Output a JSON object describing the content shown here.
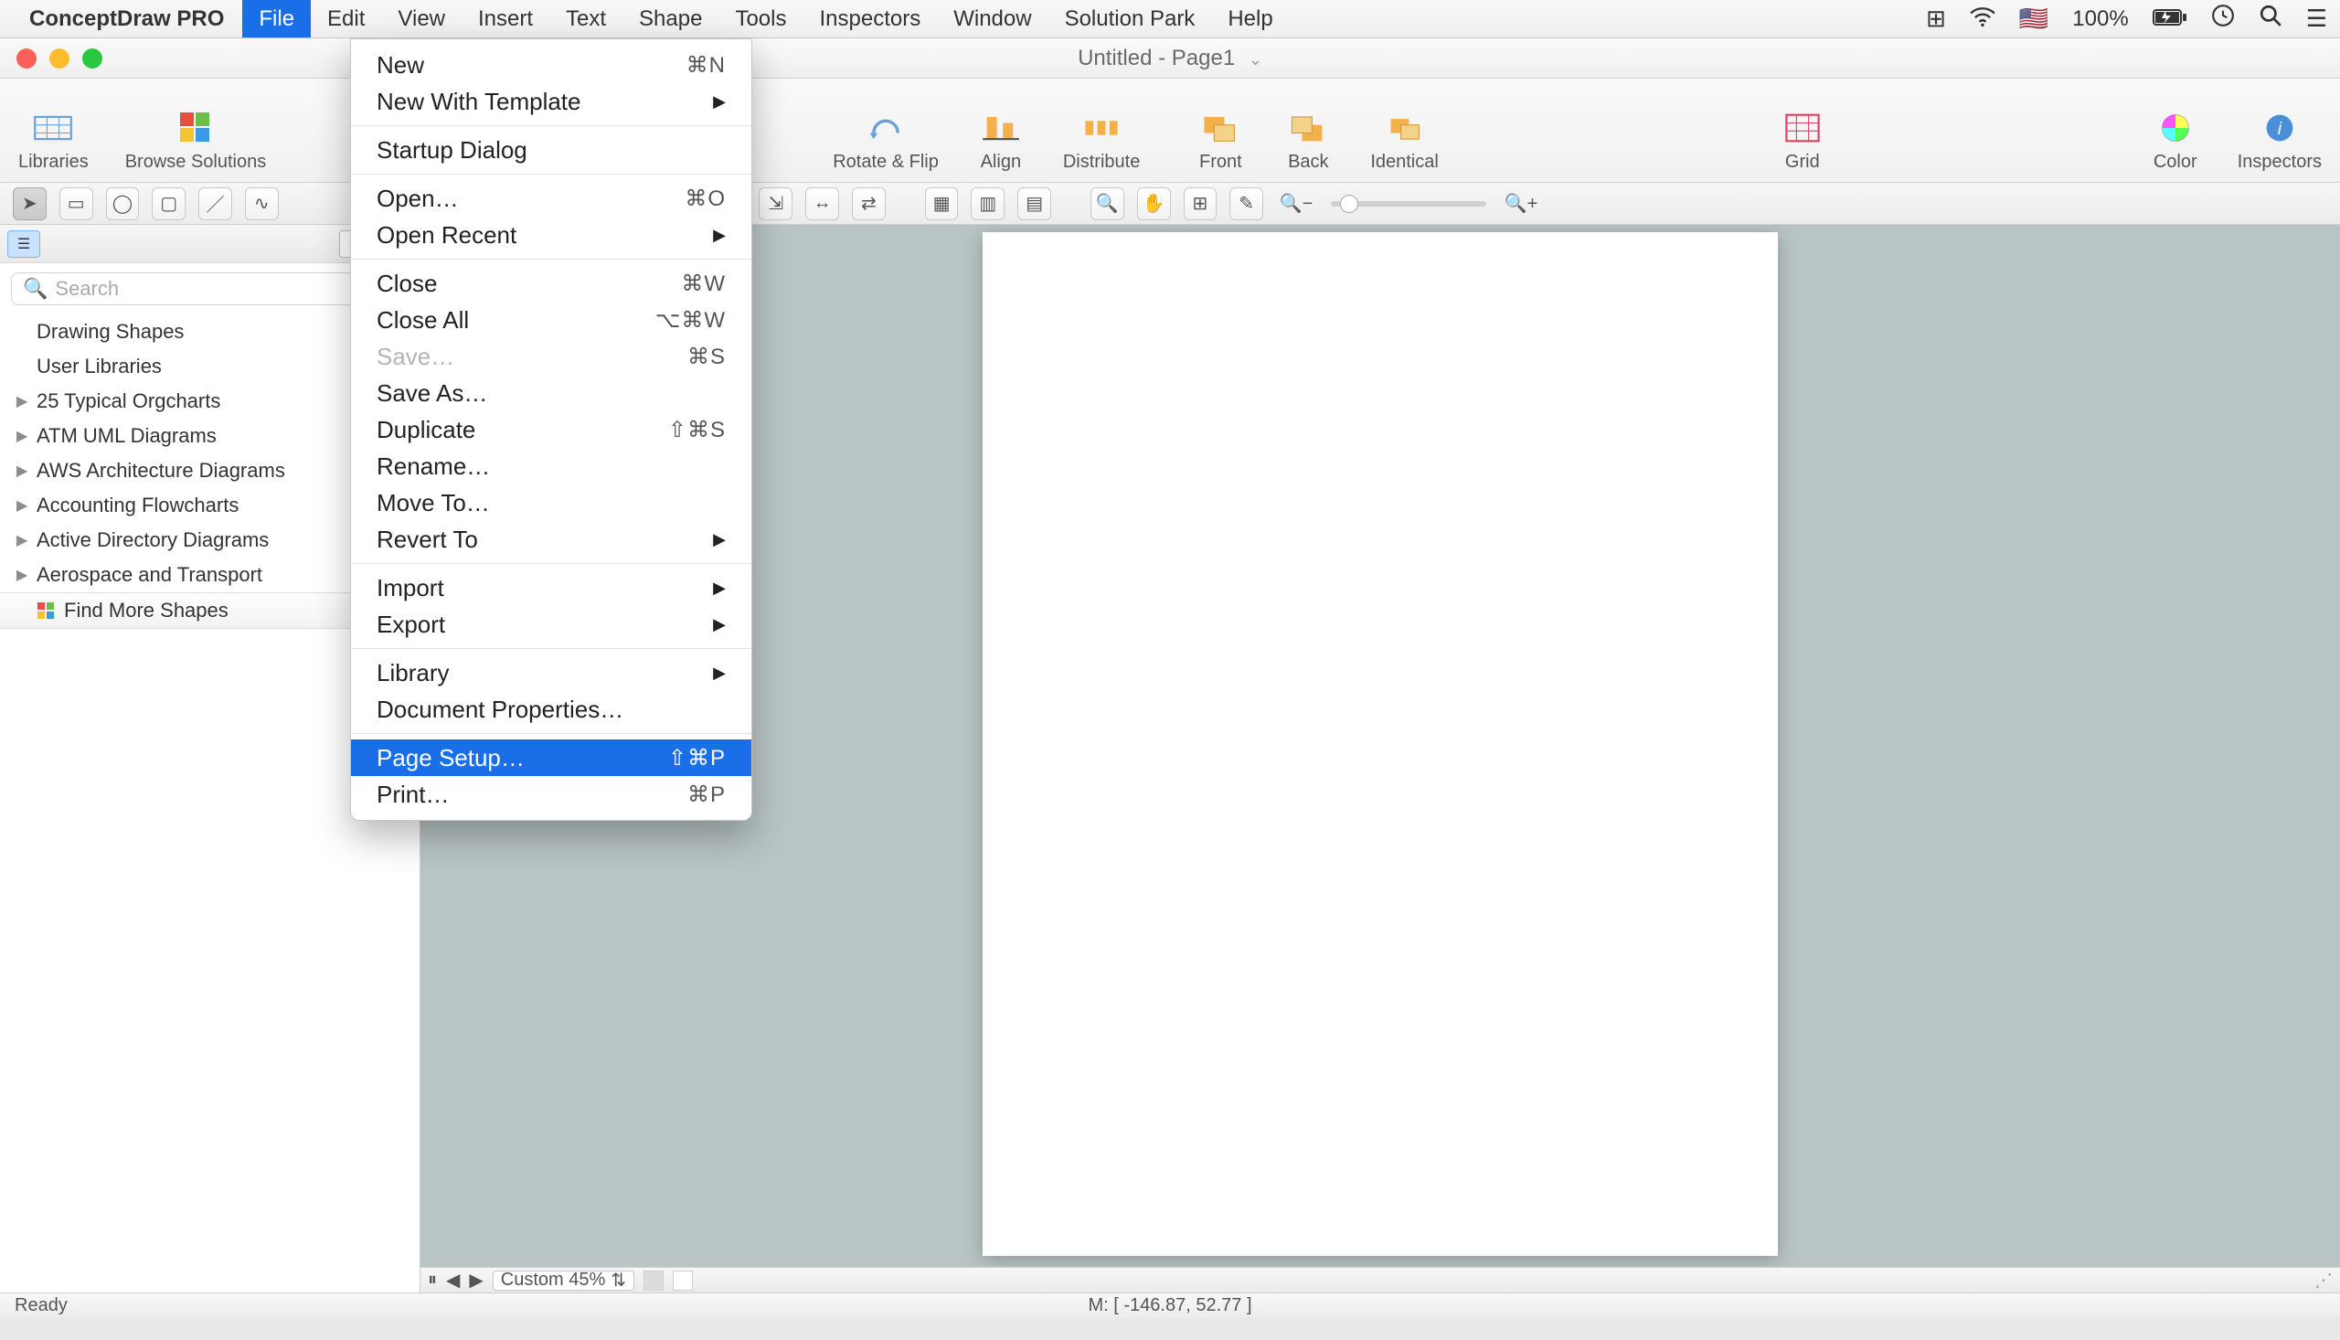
{
  "menubar": {
    "appname": "ConceptDraw PRO",
    "items": [
      "File",
      "Edit",
      "View",
      "Insert",
      "Text",
      "Shape",
      "Tools",
      "Inspectors",
      "Window",
      "Solution Park",
      "Help"
    ],
    "active_index": 0,
    "right": {
      "battery_text": "100%"
    }
  },
  "window": {
    "title": "Untitled - Page1"
  },
  "toolbar": {
    "items_left": [
      {
        "label": "Libraries"
      },
      {
        "label": "Browse Solutions"
      }
    ],
    "items_mid": [
      {
        "label": "Rotate & Flip"
      },
      {
        "label": "Align"
      },
      {
        "label": "Distribute"
      }
    ],
    "items_mid2": [
      {
        "label": "Front"
      },
      {
        "label": "Back"
      },
      {
        "label": "Identical"
      }
    ],
    "items_grid": [
      {
        "label": "Grid"
      }
    ],
    "items_right": [
      {
        "label": "Color"
      },
      {
        "label": "Inspectors"
      }
    ]
  },
  "sidebar": {
    "search_placeholder": "Search",
    "rows": [
      {
        "label": "Drawing Shapes",
        "expandable": false
      },
      {
        "label": "User Libraries",
        "expandable": false
      },
      {
        "label": "25 Typical Orgcharts",
        "expandable": true
      },
      {
        "label": "ATM UML Diagrams",
        "expandable": true
      },
      {
        "label": "AWS Architecture Diagrams",
        "expandable": true
      },
      {
        "label": "Accounting Flowcharts",
        "expandable": true
      },
      {
        "label": "Active Directory Diagrams",
        "expandable": true
      },
      {
        "label": "Aerospace and Transport",
        "expandable": true
      }
    ],
    "footer": "Find More Shapes"
  },
  "canvas": {
    "zoom_label": "Custom 45%"
  },
  "statusbar": {
    "left": "Ready",
    "mid": "M: [ -146.87, 52.77 ]"
  },
  "file_menu": {
    "groups": [
      [
        {
          "label": "New",
          "shortcut": "⌘N"
        },
        {
          "label": "New With Template",
          "submenu": true
        }
      ],
      [
        {
          "label": "Startup Dialog"
        }
      ],
      [
        {
          "label": "Open…",
          "shortcut": "⌘O"
        },
        {
          "label": "Open Recent",
          "submenu": true
        }
      ],
      [
        {
          "label": "Close",
          "shortcut": "⌘W"
        },
        {
          "label": "Close All",
          "shortcut": "⌥⌘W"
        },
        {
          "label": "Save…",
          "shortcut": "⌘S",
          "disabled": true
        },
        {
          "label": "Save As…"
        },
        {
          "label": "Duplicate",
          "shortcut": "⇧⌘S"
        },
        {
          "label": "Rename…"
        },
        {
          "label": "Move To…"
        },
        {
          "label": "Revert To",
          "submenu": true
        }
      ],
      [
        {
          "label": "Import",
          "submenu": true
        },
        {
          "label": "Export",
          "submenu": true
        }
      ],
      [
        {
          "label": "Library",
          "submenu": true
        },
        {
          "label": "Document Properties…"
        }
      ],
      [
        {
          "label": "Page Setup…",
          "shortcut": "⇧⌘P",
          "selected": true
        },
        {
          "label": "Print…",
          "shortcut": "⌘P"
        }
      ]
    ]
  }
}
